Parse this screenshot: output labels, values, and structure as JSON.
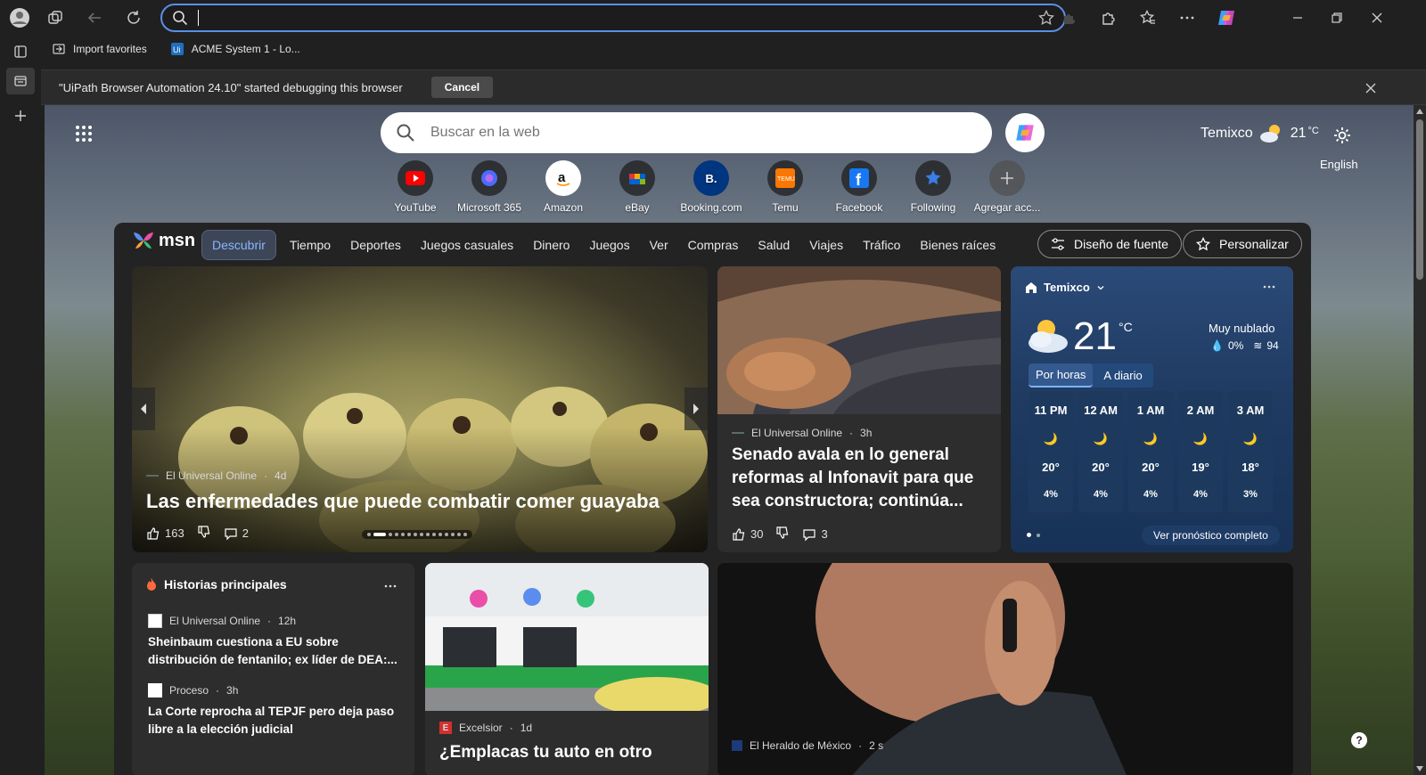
{
  "browser": {
    "address_value": "",
    "favorites": [
      {
        "label": "Import favorites",
        "icon": "import-icon"
      },
      {
        "label": "ACME System 1 - Lo...",
        "icon": "uipath-icon"
      }
    ],
    "infobar": {
      "message": "\"UiPath Browser Automation 24.10\" started debugging this browser",
      "cancel": "Cancel"
    }
  },
  "page": {
    "search_placeholder": "Buscar en la web",
    "location": "Temixco",
    "temp": "21",
    "temp_unit": "°C",
    "language": "English",
    "tiles": [
      {
        "label": "YouTube",
        "color": "#ff0000"
      },
      {
        "label": "Microsoft 365",
        "color": "#4a6cf7"
      },
      {
        "label": "Amazon",
        "color": "#ffffff"
      },
      {
        "label": "eBay",
        "color": "#e53238"
      },
      {
        "label": "Booking.com",
        "color": "#003580"
      },
      {
        "label": "Temu",
        "color": "#fb7701"
      },
      {
        "label": "Facebook",
        "color": "#1877f2"
      },
      {
        "label": "Following",
        "color": "#3b7ce6"
      },
      {
        "label": "Agregar acc...",
        "color": "#555555"
      }
    ]
  },
  "msn": {
    "logo": "msn",
    "nav": [
      "Descubrir",
      "Tiempo",
      "Deportes",
      "Juegos casuales",
      "Dinero",
      "Juegos",
      "Ver",
      "Compras",
      "Salud",
      "Viajes",
      "Tráfico",
      "Bienes raíces"
    ],
    "font_design": "Diseño de fuente",
    "personalize": "Personalizar",
    "hero": {
      "source": "El Universal Online",
      "age": "4d",
      "title": "Las enfermedades que puede combatir comer guayaba",
      "likes": "163",
      "comments": "2"
    },
    "story2": {
      "source": "El Universal Online",
      "age": "3h",
      "title": "Senado avala en lo general reformas al Infonavit para que sea constructora; continúa...",
      "likes": "30",
      "comments": "3"
    },
    "weather": {
      "location": "Temixco",
      "temp": "21",
      "unit": "°C",
      "condition": "Muy nublado",
      "precip": "0%",
      "humidity": "94",
      "tab_hourly": "Por horas",
      "tab_daily": "A diario",
      "link": "Ver pronóstico completo",
      "hours": [
        {
          "time": "11 PM",
          "temp": "20°",
          "rain": "4%"
        },
        {
          "time": "12 AM",
          "temp": "20°",
          "rain": "4%"
        },
        {
          "time": "1 AM",
          "temp": "20°",
          "rain": "4%"
        },
        {
          "time": "2 AM",
          "temp": "19°",
          "rain": "4%"
        },
        {
          "time": "3 AM",
          "temp": "18°",
          "rain": "3%"
        }
      ]
    },
    "top_stories": {
      "title": "Historias principales",
      "items": [
        {
          "source": "El Universal Online",
          "age": "12h",
          "title": "Sheinbaum cuestiona a EU sobre distribución de fentanilo; ex líder de DEA:..."
        },
        {
          "source": "Proceso",
          "age": "3h",
          "title": "La Corte reprocha al TEPJF pero deja paso libre a la elección judicial"
        }
      ]
    },
    "story3": {
      "source": "Excelsior",
      "age": "1d",
      "title": "¿Emplacas tu auto en otro"
    },
    "story4": {
      "source": "El Heraldo de México",
      "age": "2 s"
    }
  }
}
